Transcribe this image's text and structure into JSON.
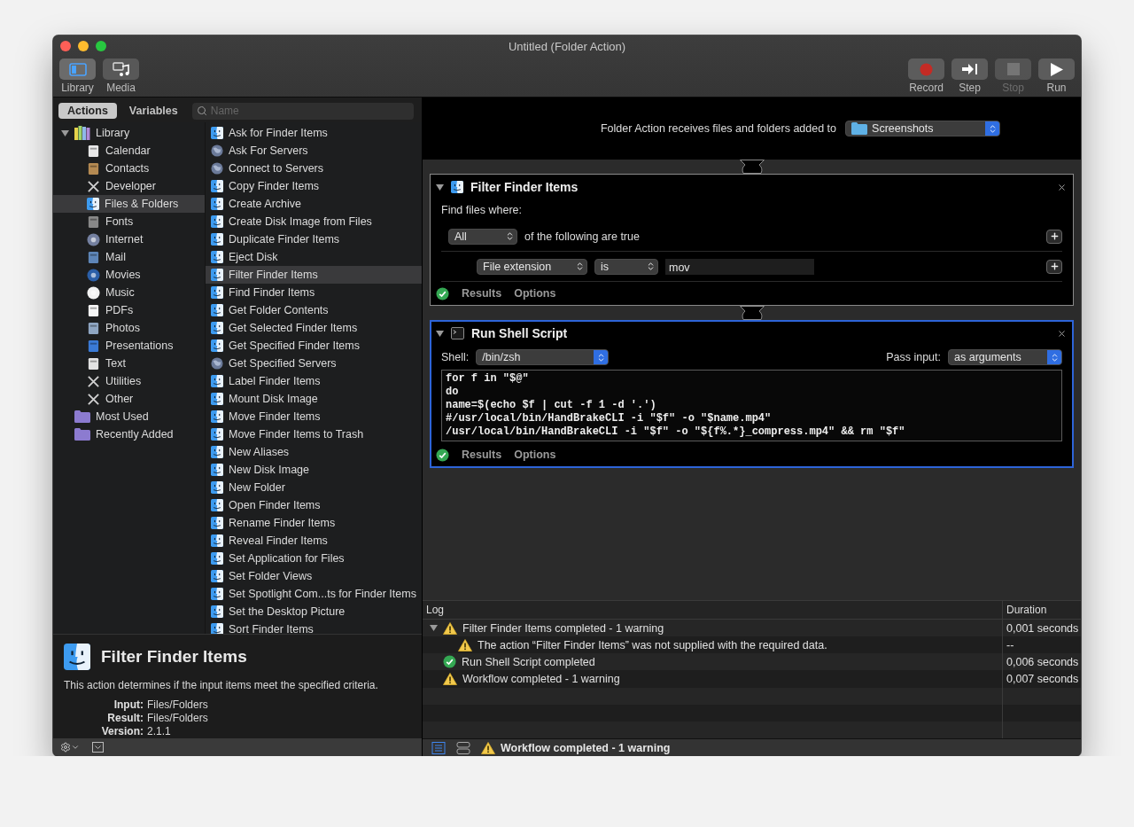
{
  "window": {
    "title": "Untitled (Folder Action)"
  },
  "toolbar": {
    "left": [
      {
        "label": "Library",
        "kind": "library",
        "selected": true
      },
      {
        "label": "Media",
        "kind": "media",
        "selected": false
      }
    ],
    "right": [
      {
        "label": "Record",
        "kind": "record",
        "disabled": false
      },
      {
        "label": "Step",
        "kind": "step",
        "disabled": false
      },
      {
        "label": "Stop",
        "kind": "stop",
        "disabled": true
      },
      {
        "label": "Run",
        "kind": "run",
        "disabled": false
      }
    ]
  },
  "library_tabs": [
    {
      "label": "Actions",
      "selected": true
    },
    {
      "label": "Variables",
      "selected": false
    }
  ],
  "search": {
    "placeholder": "Name"
  },
  "categories": [
    {
      "label": "Library",
      "kind": "library",
      "expanded": true,
      "selected": false,
      "children": [
        {
          "label": "Calendar",
          "selected": false
        },
        {
          "label": "Contacts",
          "selected": false
        },
        {
          "label": "Developer",
          "selected": false
        },
        {
          "label": "Files & Folders",
          "selected": true
        },
        {
          "label": "Fonts",
          "selected": false
        },
        {
          "label": "Internet",
          "selected": false
        },
        {
          "label": "Mail",
          "selected": false
        },
        {
          "label": "Movies",
          "selected": false
        },
        {
          "label": "Music",
          "selected": false
        },
        {
          "label": "PDFs",
          "selected": false
        },
        {
          "label": "Photos",
          "selected": false
        },
        {
          "label": "Presentations",
          "selected": false
        },
        {
          "label": "Text",
          "selected": false
        },
        {
          "label": "Utilities",
          "selected": false
        },
        {
          "label": "Other",
          "selected": false
        }
      ]
    },
    {
      "label": "Most Used",
      "kind": "folder",
      "selected": false
    },
    {
      "label": "Recently Added",
      "kind": "folder",
      "selected": false
    }
  ],
  "actions": [
    {
      "label": "Ask for Finder Items",
      "kind": "finder",
      "selected": false
    },
    {
      "label": "Ask For Servers",
      "kind": "server",
      "selected": false
    },
    {
      "label": "Connect to Servers",
      "kind": "server",
      "selected": false
    },
    {
      "label": "Copy Finder Items",
      "kind": "finder",
      "selected": false
    },
    {
      "label": "Create Archive",
      "kind": "finder",
      "selected": false
    },
    {
      "label": "Create Disk Image from Files",
      "kind": "finder",
      "selected": false
    },
    {
      "label": "Duplicate Finder Items",
      "kind": "finder",
      "selected": false
    },
    {
      "label": "Eject Disk",
      "kind": "finder",
      "selected": false
    },
    {
      "label": "Filter Finder Items",
      "kind": "finder",
      "selected": true
    },
    {
      "label": "Find Finder Items",
      "kind": "finder",
      "selected": false
    },
    {
      "label": "Get Folder Contents",
      "kind": "finder",
      "selected": false
    },
    {
      "label": "Get Selected Finder Items",
      "kind": "finder",
      "selected": false
    },
    {
      "label": "Get Specified Finder Items",
      "kind": "finder",
      "selected": false
    },
    {
      "label": "Get Specified Servers",
      "kind": "server",
      "selected": false
    },
    {
      "label": "Label Finder Items",
      "kind": "finder",
      "selected": false
    },
    {
      "label": "Mount Disk Image",
      "kind": "finder",
      "selected": false
    },
    {
      "label": "Move Finder Items",
      "kind": "finder",
      "selected": false
    },
    {
      "label": "Move Finder Items to Trash",
      "kind": "finder",
      "selected": false
    },
    {
      "label": "New Aliases",
      "kind": "finder",
      "selected": false
    },
    {
      "label": "New Disk Image",
      "kind": "finder",
      "selected": false
    },
    {
      "label": "New Folder",
      "kind": "finder",
      "selected": false
    },
    {
      "label": "Open Finder Items",
      "kind": "finder",
      "selected": false
    },
    {
      "label": "Rename Finder Items",
      "kind": "finder",
      "selected": false
    },
    {
      "label": "Reveal Finder Items",
      "kind": "finder",
      "selected": false
    },
    {
      "label": "Set Application for Files",
      "kind": "finder",
      "selected": false
    },
    {
      "label": "Set Folder Views",
      "kind": "finder",
      "selected": false
    },
    {
      "label": "Set Spotlight Com...ts for Finder Items",
      "kind": "finder",
      "selected": false
    },
    {
      "label": "Set the Desktop Picture",
      "kind": "finder",
      "selected": false
    },
    {
      "label": "Sort Finder Items",
      "kind": "finder",
      "selected": false
    }
  ],
  "description": {
    "title": "Filter Finder Items",
    "text": "This action determines if the input items meet the specified criteria.",
    "fields": [
      {
        "label": "Input:",
        "value": "Files/Folders"
      },
      {
        "label": "Result:",
        "value": "Files/Folders"
      },
      {
        "label": "Version:",
        "value": "2.1.1"
      }
    ]
  },
  "workflow": {
    "receives_label": "Folder Action receives files and folders added to",
    "folder": "Screenshots",
    "actions": [
      {
        "kind": "filter",
        "title": "Filter Finder Items",
        "selected": false,
        "expanded": true,
        "completed": true,
        "find_label": "Find files where:",
        "match": "All",
        "match_suffix": "of the following are true",
        "conditions": [
          {
            "field": "File extension",
            "operator": "is",
            "value": "mov"
          }
        ],
        "footer": [
          "Results",
          "Options"
        ]
      },
      {
        "kind": "shell",
        "title": "Run Shell Script",
        "selected": true,
        "expanded": true,
        "completed": true,
        "shell_label": "Shell:",
        "shell": "/bin/zsh",
        "pass_label": "Pass input:",
        "pass": "as arguments",
        "script": [
          "for f in \"$@\"",
          "do",
          "name=$(echo $f | cut -f 1 -d '.')",
          "#/usr/local/bin/HandBrakeCLI -i \"$f\" -o \"$name.mp4\"",
          "/usr/local/bin/HandBrakeCLI -i \"$f\" -o \"${f%.*}_compress.mp4\" && rm \"$f\""
        ],
        "footer": [
          "Results",
          "Options"
        ]
      }
    ]
  },
  "log": {
    "columns": [
      "Log",
      "Duration"
    ],
    "rows": [
      {
        "kind": "warning",
        "text": "Filter Finder Items completed - 1 warning",
        "duration": "0,001 seconds",
        "expanded": true,
        "children": [
          {
            "kind": "warning",
            "text": "The action “Filter Finder Items” was not supplied with the required data.",
            "duration": "--"
          }
        ]
      },
      {
        "kind": "ok",
        "text": "Run Shell Script completed",
        "duration": "0,006 seconds"
      },
      {
        "kind": "warning",
        "text": "Workflow completed - 1 warning",
        "duration": "0,007 seconds"
      }
    ]
  },
  "status_bar": {
    "views": [
      {
        "kind": "list",
        "selected": true
      },
      {
        "kind": "split",
        "selected": false
      }
    ],
    "kind": "warning",
    "text": "Workflow completed - 1 warning"
  }
}
